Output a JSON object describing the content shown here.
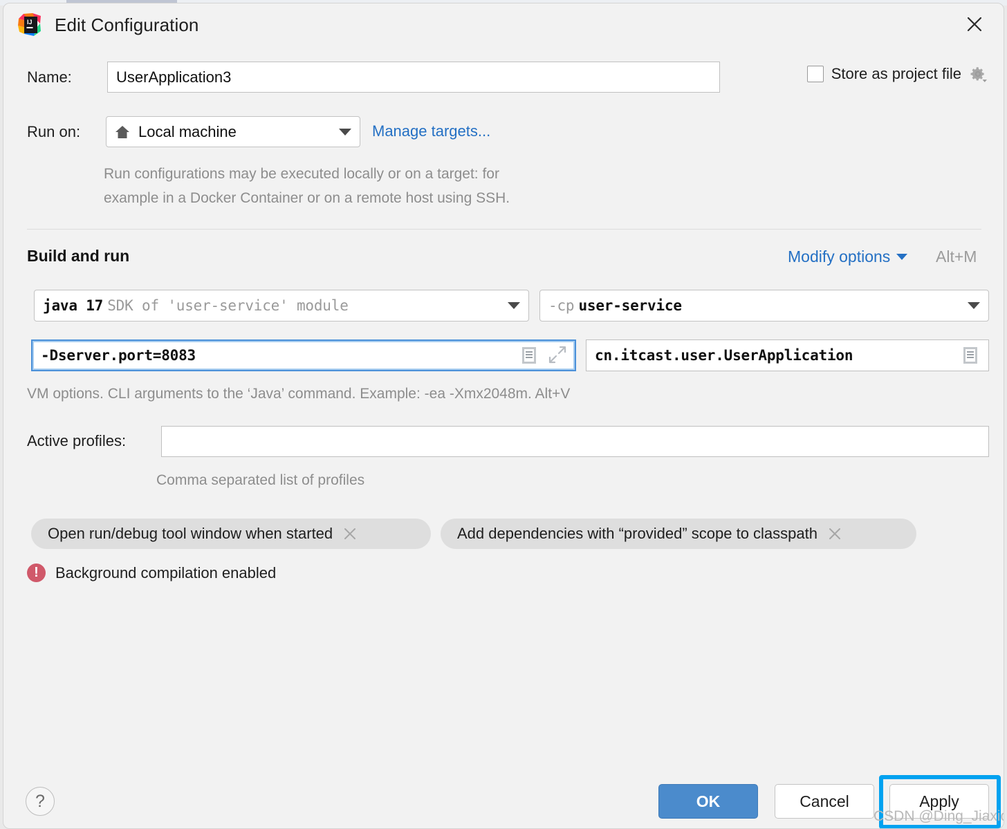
{
  "window": {
    "title": "Edit Configuration",
    "app_icon": "intellij-idea-logo",
    "close_icon": "close-icon"
  },
  "name_row": {
    "label": "Name:",
    "value": "UserApplication3",
    "placeholder": ""
  },
  "store_as_project_file": {
    "label": "Store as project file",
    "checked": false,
    "gear_icon": "gear-icon"
  },
  "run_on_row": {
    "label": "Run on:",
    "selected": "Local machine",
    "target_icon": "home-icon",
    "manage_targets_link": "Manage targets...",
    "description_line1": "Run configurations may be executed locally or on a target: for",
    "description_line2": "example in a Docker Container or on a remote host using SSH."
  },
  "build_and_run": {
    "section_title": "Build and run",
    "modify_options_label": "Modify options",
    "modify_options_shortcut": "Alt+M",
    "jre_combo": {
      "primary": "java 17",
      "secondary": "SDK of 'user-service' module"
    },
    "classpath_combo": {
      "prefix": "-cp",
      "value": "user-service"
    },
    "vm_options": {
      "value": "-Dserver.port=8083",
      "focused": true,
      "expand_icon": "expand-icon",
      "list_icon": "document-list-icon"
    },
    "main_class": {
      "value": "cn.itcast.user.UserApplication",
      "list_icon": "document-list-icon"
    },
    "vm_options_hint": "VM options. CLI arguments to the ‘Java’ command. Example: -ea -Xmx2048m. Alt+V"
  },
  "active_profiles": {
    "label": "Active profiles:",
    "value": "",
    "hint": "Comma separated list of profiles"
  },
  "chips": [
    {
      "label": "Open run/debug tool window when started",
      "close_icon": "chip-close-icon"
    },
    {
      "label": "Add dependencies with “provided” scope to classpath",
      "close_icon": "chip-close-icon"
    }
  ],
  "error": {
    "icon": "error-circle-icon",
    "message": "Background compilation enabled"
  },
  "footer": {
    "help_label": "?",
    "ok_label": "OK",
    "cancel_label": "Cancel",
    "apply_label": "Apply"
  },
  "watermark": "CSDN @Ding_Jiaxiong",
  "colors": {
    "dialog_background": "#f2f2f2",
    "link_blue": "#2470c4",
    "ok_button_blue": "#4b8bcc",
    "focus_blue": "#4a90d9",
    "highlight_cyan": "#00a2f0",
    "error_red": "#d0596a",
    "chip_gray": "#dedede",
    "hint_gray": "#8d8d8d"
  }
}
